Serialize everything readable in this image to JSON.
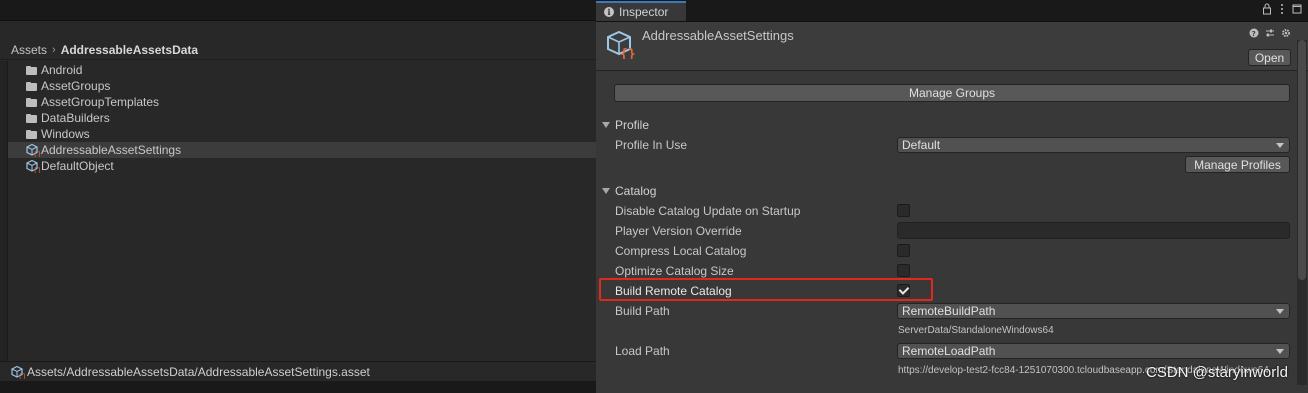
{
  "project": {
    "breadcrumb": {
      "root": "Assets",
      "separator": "›",
      "current": "AddressableAssetsData"
    },
    "items": [
      {
        "label": "Android",
        "icon": "folder-icon"
      },
      {
        "label": "AssetGroups",
        "icon": "folder-icon"
      },
      {
        "label": "AssetGroupTemplates",
        "icon": "folder-icon"
      },
      {
        "label": "DataBuilders",
        "icon": "folder-icon"
      },
      {
        "label": "Windows",
        "icon": "folder-icon"
      },
      {
        "label": "AddressableAssetSettings",
        "icon": "addressable-asset-icon",
        "selected": true
      },
      {
        "label": "DefaultObject",
        "icon": "addressable-asset-icon"
      }
    ],
    "status_path": "Assets/AddressableAssetsData/AddressableAssetSettings.asset"
  },
  "inspector": {
    "tab_label": "Inspector",
    "info_glyph": "i",
    "asset_title": "AddressableAssetSettings",
    "open_label": "Open",
    "manage_groups_label": "Manage Groups",
    "profile_section": "Profile",
    "profile_in_use_label": "Profile In Use",
    "profile_in_use_value": "Default",
    "manage_profiles_label": "Manage Profiles",
    "catalog_section": "Catalog",
    "disable_catalog_update_label": "Disable Catalog Update on Startup",
    "disable_catalog_update_checked": false,
    "player_version_override_label": "Player Version Override",
    "player_version_override_value": "",
    "compress_local_catalog_label": "Compress Local Catalog",
    "compress_local_catalog_checked": false,
    "optimize_catalog_size_label": "Optimize Catalog Size",
    "optimize_catalog_size_checked": false,
    "build_remote_catalog_label": "Build Remote Catalog",
    "build_remote_catalog_checked": true,
    "build_path_label": "Build Path",
    "build_path_value": "RemoteBuildPath",
    "build_path_resolved": "ServerData/StandaloneWindows64",
    "load_path_label": "Load Path",
    "load_path_value": "RemoteLoadPath",
    "load_path_resolved": "https://develop-test2-fcc84-1251070300.tcloudbaseapp.com/StandaloneWindows64"
  },
  "watermark": "CSDN @staryinworld",
  "colors": {
    "highlight_box": "#e0281f",
    "tab_accent": "#3a79bb"
  }
}
